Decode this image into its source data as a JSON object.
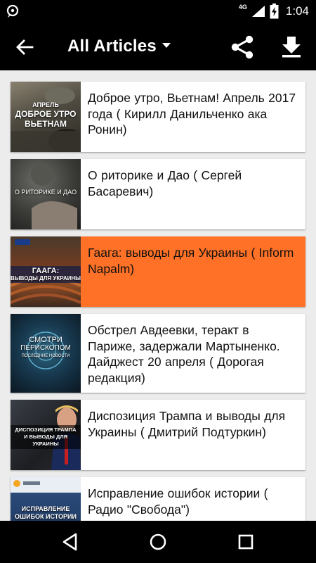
{
  "status_bar": {
    "network": "4G",
    "time": "1:04",
    "icons": [
      "notification-icon",
      "signal-icon",
      "battery-charging-icon"
    ]
  },
  "app_bar": {
    "title": "All Articles",
    "icons": [
      "back-arrow-icon",
      "dropdown-arrow-icon",
      "share-icon",
      "download-icon"
    ]
  },
  "articles": [
    {
      "text": "Доброе утро, Вьетнам! Апрель 2017 года ( Кирилл Данильченко ака Ронин)",
      "thumb_caption": [
        "АПРЕЛЬ",
        "ДОБРОЕ УТРО",
        "ВЬЕТНАМ"
      ]
    },
    {
      "text": "О риторике и Дао ( Сергей Басаревич)",
      "thumb_caption": [
        "О РИТОРИКЕ И ДАО"
      ]
    },
    {
      "text": "Гаага: выводы для Украины ( Inform Napalm)",
      "thumb_caption": [
        "ГААГА:",
        "ВЫВОДЫ ДЛЯ УКРАИНЫ"
      ],
      "selected": true
    },
    {
      "text": "Обстрел Авдеевки, теракт в Париже, задержали Мартыненко. Дайджест 20 апреля ( Дорогая редакция)",
      "thumb_caption": [
        "СМОТРИ",
        "ПЕРИСКОПОМ",
        "ПОСЛЕДНИЕ НОВОСТИ"
      ]
    },
    {
      "text": "Диспозиция Трампа и выводы для Украины ( Дмитрий Подтуркин)",
      "thumb_caption": [
        "ДИСПОЗИЦИЯ ТРАМПА",
        "И ВЫВОДЫ ДЛЯ УКРАИНЫ"
      ]
    },
    {
      "text": "Исправление ошибок истории ( Радио \"Свобода\")",
      "thumb_caption": [
        "ИСПРАВЛЕНИЕ",
        "ОШИБОК ИСТОРИИ"
      ]
    }
  ],
  "nav_bar": {
    "icons": [
      "back-triangle-icon",
      "home-circle-icon",
      "recents-square-icon"
    ]
  },
  "colors": {
    "selected": "#ff7126",
    "bar": "#000000",
    "background": "#ececec"
  }
}
